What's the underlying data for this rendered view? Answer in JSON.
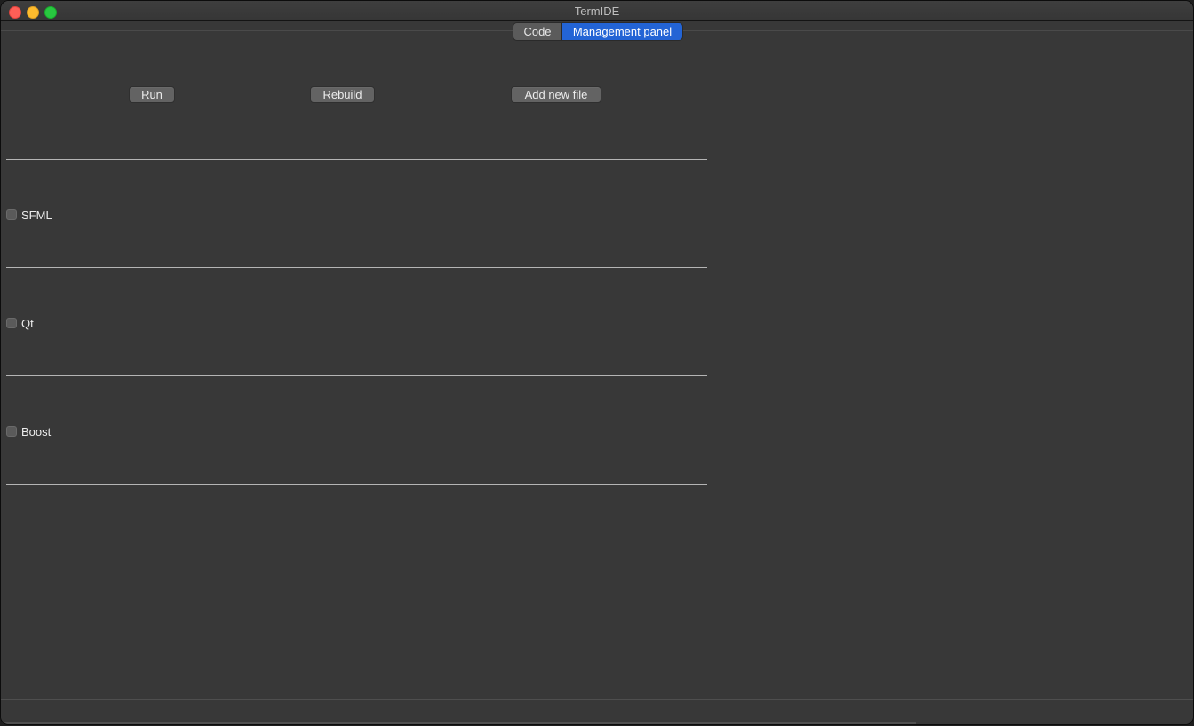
{
  "window": {
    "title": "TermIDE"
  },
  "tabs": [
    {
      "label": "Code",
      "active": false
    },
    {
      "label": "Management panel",
      "active": true
    }
  ],
  "toolbar": {
    "run_label": "Run",
    "rebuild_label": "Rebuild",
    "add_file_label": "Add new file"
  },
  "libraries": [
    {
      "label": "SFML",
      "checked": false
    },
    {
      "label": "Qt",
      "checked": false
    },
    {
      "label": "Boost",
      "checked": false
    }
  ],
  "colors": {
    "window_bg": "#383838",
    "active_tab": "#2364d5",
    "close": "#fe5f57",
    "minimize": "#febc2e",
    "maximize": "#28c840"
  }
}
